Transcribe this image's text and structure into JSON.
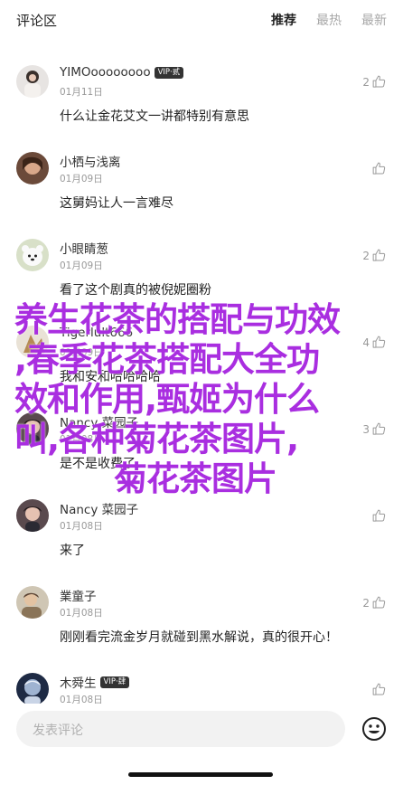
{
  "header": {
    "title": "评论区",
    "tabs": [
      {
        "label": "推荐",
        "active": true
      },
      {
        "label": "最热",
        "active": false
      },
      {
        "label": "最新",
        "active": false
      }
    ]
  },
  "comments": [
    {
      "name": "YIMOoooooooo",
      "vip": "VIP·贰",
      "date": "01月11日",
      "text": "什么让金花艾文一讲都特别有意思",
      "likes": "2"
    },
    {
      "name": "小栖与浅离",
      "vip": "",
      "date": "01月09日",
      "text": "这舅妈让人一言难尽",
      "likes": ""
    },
    {
      "name": "小眼睛葱",
      "vip": "",
      "date": "01月09日",
      "text": "看了这个剧真的被倪妮圈粉",
      "likes": "2"
    },
    {
      "name": "Tigerlult666",
      "vip": "",
      "date": "01月09日",
      "text": "我和安和哈哈哈哈",
      "likes": "4"
    },
    {
      "name": "Nancy 菜园子",
      "vip": "",
      "date": "01月08日",
      "text": "是不是收费了",
      "likes": "3"
    },
    {
      "name": "Nancy 菜园子",
      "vip": "",
      "date": "01月08日",
      "text": "来了",
      "likes": ""
    },
    {
      "name": "業童子",
      "vip": "",
      "date": "01月08日",
      "text": "刚刚看完流金岁月就碰到黑水解说，真的很开心！",
      "likes": "2"
    },
    {
      "name": "木舜生",
      "vip": "VIP·肆",
      "date": "01月08日",
      "text": "",
      "likes": ""
    }
  ],
  "overlay": {
    "lines": [
      "养生花茶的搭配与功效",
      ",春季花茶搭配大全功",
      "效和作用,甄姬为什么",
      "叫,各种菊花茶图片,",
      "菊花茶图片"
    ]
  },
  "bottom": {
    "placeholder": "发表评论"
  },
  "colors": {
    "overlay_text": "#a92ee0",
    "vip_badge": "#333333",
    "muted": "#999999"
  }
}
